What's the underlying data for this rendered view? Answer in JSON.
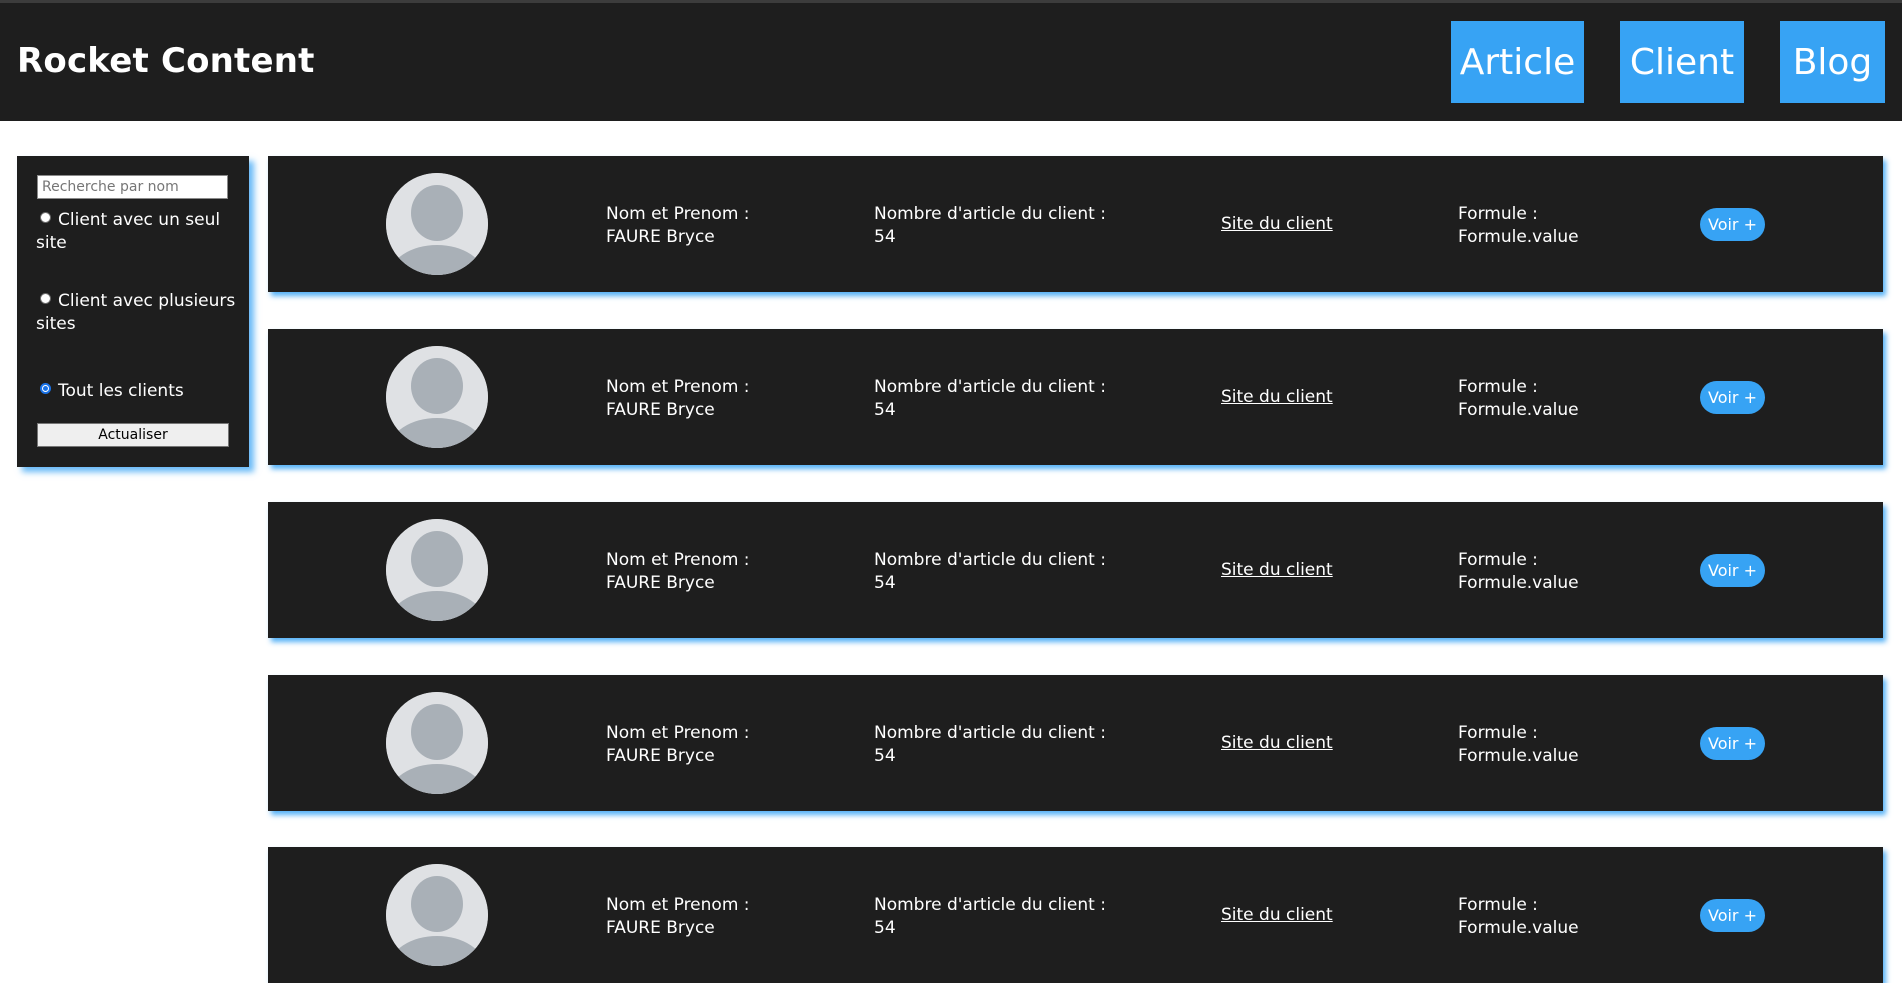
{
  "header": {
    "brand": "Rocket Content",
    "nav": [
      "Article",
      "Client",
      "Blog"
    ]
  },
  "sidebar": {
    "search_placeholder": "Recherche par nom",
    "options": [
      {
        "label": "Client avec un seul site",
        "checked": false
      },
      {
        "label": "Client avec plusieurs sites",
        "checked": false
      },
      {
        "label": "Tout les clients",
        "checked": true
      }
    ],
    "refresh_label": "Actualiser"
  },
  "clients": [
    {
      "name_label": "Nom et Prenom :",
      "name": "FAURE Bryce",
      "count_label": "Nombre d'article du client :",
      "count": "54",
      "site_link": "Site du client",
      "formule_label": "Formule :",
      "formule": "Formule.value",
      "button": "Voir +"
    },
    {
      "name_label": "Nom et Prenom :",
      "name": "FAURE Bryce",
      "count_label": "Nombre d'article du client :",
      "count": "54",
      "site_link": "Site du client",
      "formule_label": "Formule :",
      "formule": "Formule.value",
      "button": "Voir +"
    },
    {
      "name_label": "Nom et Prenom :",
      "name": "FAURE Bryce",
      "count_label": "Nombre d'article du client :",
      "count": "54",
      "site_link": "Site du client",
      "formule_label": "Formule :",
      "formule": "Formule.value",
      "button": "Voir +"
    },
    {
      "name_label": "Nom et Prenom :",
      "name": "FAURE Bryce",
      "count_label": "Nombre d'article du client :",
      "count": "54",
      "site_link": "Site du client",
      "formule_label": "Formule :",
      "formule": "Formule.value",
      "button": "Voir +"
    },
    {
      "name_label": "Nom et Prenom :",
      "name": "FAURE Bryce",
      "count_label": "Nombre d'article du client :",
      "count": "54",
      "site_link": "Site du client",
      "formule_label": "Formule :",
      "formule": "Formule.value",
      "button": "Voir +"
    }
  ],
  "colors": {
    "header_bg": "#1e1e1e",
    "accent": "#37a3f4",
    "avatar_bg": "#dfe1e4",
    "avatar_figure": "#a9b0b7"
  },
  "icons": {
    "avatar": "user-silhouette-icon"
  }
}
